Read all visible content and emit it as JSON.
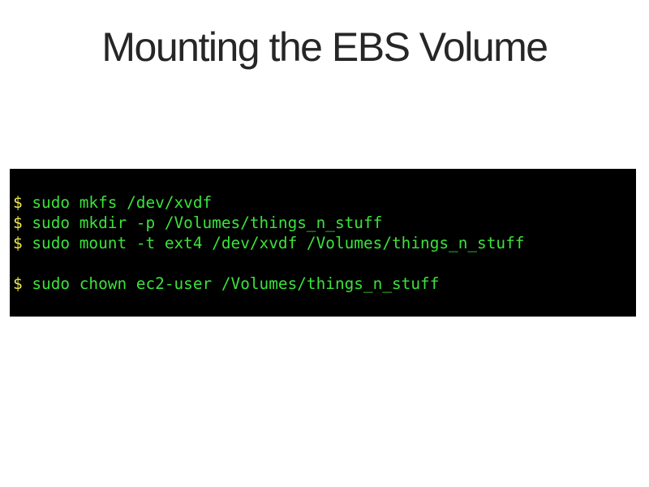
{
  "slide": {
    "title": "Mounting the EBS Volume"
  },
  "terminal": {
    "prompt": "$",
    "lines": [
      {
        "prompt": "$",
        "command": "sudo mkfs /dev/xvdf"
      },
      {
        "prompt": "$",
        "command": "sudo mkdir -p /Volumes/things_n_stuff"
      },
      {
        "prompt": "$",
        "command": "sudo mount -t ext4 /dev/xvdf /Volumes/things_n_stuff"
      },
      {
        "prompt": "$",
        "command": "sudo chown ec2-user /Volumes/things_n_stuff"
      }
    ]
  },
  "colors": {
    "background": "#ffffff",
    "title_text": "#262626",
    "terminal_background": "#000000",
    "prompt": "#f2e94e",
    "command": "#3be23b"
  }
}
